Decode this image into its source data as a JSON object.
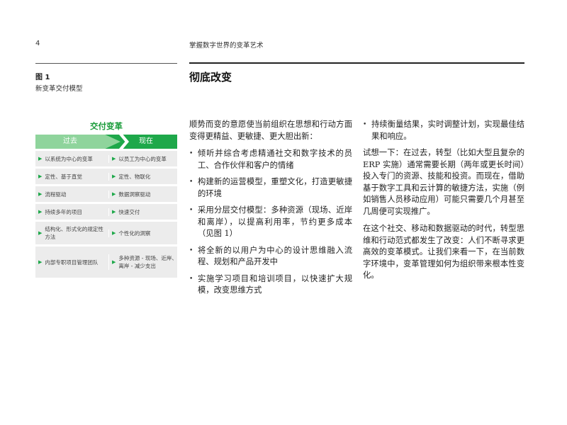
{
  "header": {
    "page_number": "4",
    "running_title": "掌握数字世界的变革艺术"
  },
  "figure": {
    "label": "图 1",
    "caption": "新变革交付模型",
    "title": "交付变革",
    "col_past": "过去",
    "col_now": "现在",
    "rows": [
      {
        "past": "以系统为中心的变革",
        "now": "以员工为中心的变革"
      },
      {
        "past": "定性、基于直觉",
        "now": "定性、物联化"
      },
      {
        "past": "流程驱动",
        "now": "数据洞察驱动"
      },
      {
        "past": "持续多年的项目",
        "now": "快速交付"
      },
      {
        "past": "结构化、形式化的规定性方法",
        "now": "个性化的洞察"
      },
      {
        "past": "内部专职项目管理团队",
        "now": "多种资源 - 现场、近岸、离岸 - 减少支出"
      }
    ]
  },
  "section": {
    "title": "彻底改变"
  },
  "body": {
    "intro": "顺势而变的意愿使当前组织在思想和行动方面变得更精益、更敏捷、更大胆出新：",
    "bullets": [
      "倾听并综合考虑精通社交和数字技术的员工、合作伙伴和客户的情绪",
      "构建新的运营模型，重塑文化，打造更敏捷的环境",
      "采用分层交付模型：多种资源（现场、近岸和离岸），以提高利用率，节约更多成本（见图 1）",
      "将全新的以用户为中心的设计思维融入流程、规划和产品开发中",
      "实施学习项目和培训项目，以快速扩大规模，改变思维方式"
    ],
    "col2_bullet": "持续衡量结果，实时调整计划，实现最佳结果和响应。",
    "para1": "试想一下：在过去，转型（比如大型且复杂的 ERP 实施）通常需要长期（两年或更长时间）投入专门的资源、技能和投资。而现在，借助基于数字工具和云计算的敏捷方法，实施（例如销售人员移动应用）可能只需要几个月甚至几周便可实现推广。",
    "para2": "在这个社交、移动和数据驱动的时代，转型思维和行动范式都发生了改变：人们不断寻求更高效的变革模式。让我们来看一下，在当前数字环境中，变革管理如何为组织带来根本性变化。"
  },
  "colors": {
    "accent_green": "#1ea84a",
    "light_green": "#8fd49c",
    "row_gray": "#ececec"
  }
}
